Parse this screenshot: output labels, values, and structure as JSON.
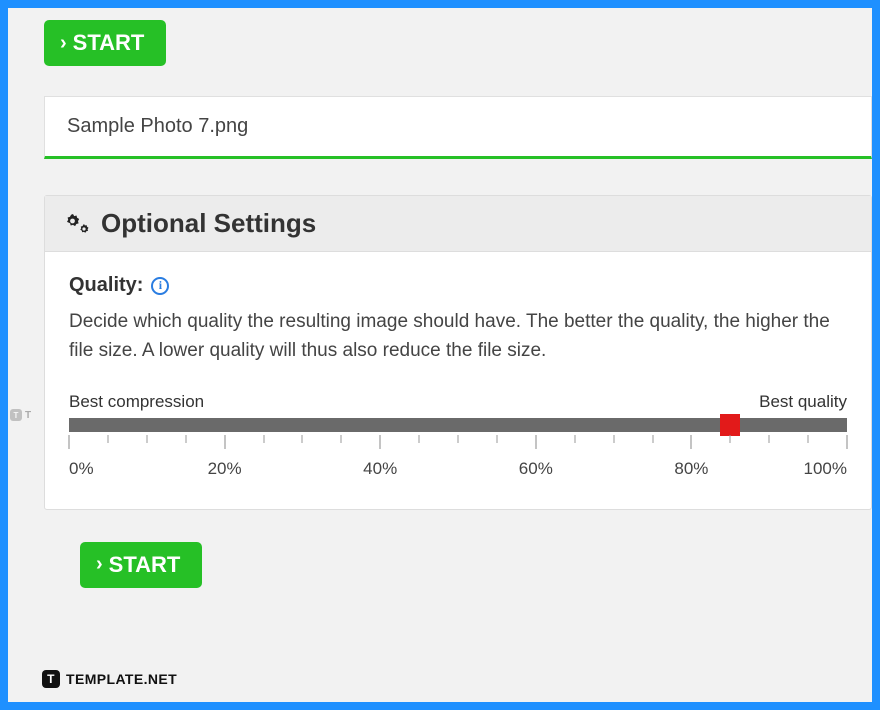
{
  "buttons": {
    "start_top": "START",
    "start_bottom": "START"
  },
  "filename": "Sample Photo 7.png",
  "settings": {
    "header": "Optional Settings",
    "quality_label": "Quality:",
    "quality_desc": "Decide which quality the resulting image should have. The better the quality, the higher the file size. A lower quality will thus also reduce the file size.",
    "slider": {
      "left_label": "Best compression",
      "right_label": "Best quality",
      "value_percent": 85,
      "ticks": {
        "major": [
          0,
          20,
          40,
          60,
          80,
          100
        ],
        "minor": [
          5,
          10,
          15,
          25,
          30,
          35,
          45,
          50,
          55,
          65,
          70,
          75,
          85,
          90,
          95
        ],
        "labels": [
          "0%",
          "20%",
          "40%",
          "60%",
          "80%",
          "100%"
        ]
      }
    }
  },
  "watermark": "TEMPLATE.NET",
  "watermark_left": "T"
}
